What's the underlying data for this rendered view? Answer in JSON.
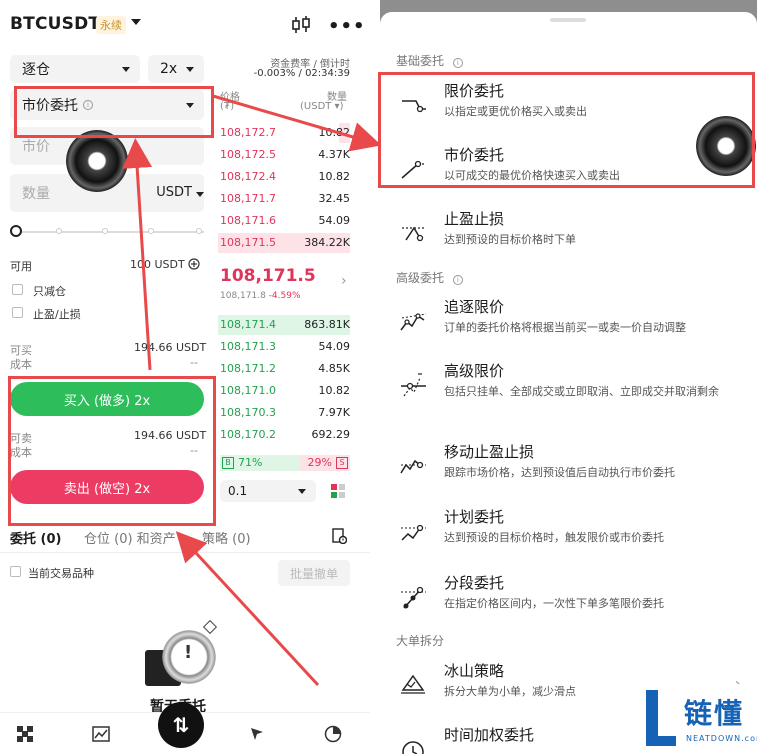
{
  "left": {
    "symbol": "BTCUSDT",
    "perp_badge": "永续",
    "margin_mode": "逐仓",
    "leverage": "2x",
    "funding_label": "资金费率 / 倒计时",
    "funding_value": "-0.003% / 02:34:39",
    "order_type": "市价委托",
    "price_placeholder": "市价",
    "qty_placeholder": "数量",
    "qty_unit": "USDT",
    "available_label": "可用",
    "available_value": "100 USDT",
    "reduce_only": "只减仓",
    "tp_sl": "止盈/止损",
    "can_buy_label": "可买",
    "can_buy_value": "194.66 USDT",
    "cost_label": "成本",
    "cost_value": "--",
    "buy_button": "买入 (做多) 2x",
    "can_sell_label": "可卖",
    "can_sell_value": "194.66 USDT",
    "cost2_label": "成本",
    "cost2_value": "--",
    "sell_button": "卖出 (做空) 2x",
    "orderbook": {
      "price_header": "价格",
      "price_unit": "(₮)",
      "qty_header": "数量",
      "qty_unit": "(USDT ▾)",
      "asks": [
        {
          "price": "108,172.7",
          "qty": "10.82",
          "depth": 0.08
        },
        {
          "price": "108,172.5",
          "qty": "4.37K",
          "depth": 0.0
        },
        {
          "price": "108,172.4",
          "qty": "10.82",
          "depth": 0.0
        },
        {
          "price": "108,171.7",
          "qty": "32.45",
          "depth": 0.0
        },
        {
          "price": "108,171.6",
          "qty": "54.09",
          "depth": 0.0
        },
        {
          "price": "108,171.5",
          "qty": "384.22K",
          "depth": 1.0
        }
      ],
      "mid_price": "108,171.5",
      "mark_price": "108,171.8",
      "change": "-4.59%",
      "bids": [
        {
          "price": "108,171.4",
          "qty": "863.81K",
          "depth": 1.0
        },
        {
          "price": "108,171.3",
          "qty": "54.09",
          "depth": 0.0
        },
        {
          "price": "108,171.2",
          "qty": "4.85K",
          "depth": 0.0
        },
        {
          "price": "108,171.0",
          "qty": "10.82",
          "depth": 0.0
        },
        {
          "price": "108,170.3",
          "qty": "7.97K",
          "depth": 0.0
        },
        {
          "price": "108,170.2",
          "qty": "692.29",
          "depth": 0.0
        }
      ],
      "buy_tag": "B",
      "buy_ratio": "71%",
      "sell_ratio": "29%",
      "sell_tag": "S",
      "precision": "0.1"
    },
    "tabs": {
      "orders": "委托 (0)",
      "positions": "仓位 (0) 和资产",
      "strategy": "策略 (0)"
    },
    "current_symbol_only": "当前交易品种",
    "batch_cancel": "批量撤单",
    "empty_text": "暂无委托",
    "nav_center": "⇅"
  },
  "right": {
    "basic_title": "基础委托",
    "advanced_title": "高级委托",
    "split_title": "大单拆分",
    "basic": [
      {
        "name": "限价委托",
        "desc": "以指定或更优价格买入或卖出"
      },
      {
        "name": "市价委托",
        "desc": "以可成交的最优价格快速买入或卖出"
      },
      {
        "name": "止盈止损",
        "desc": "达到预设的目标价格时下单"
      }
    ],
    "advanced": [
      {
        "name": "追逐限价",
        "desc": "订单的委托价格将根据当前买一或卖一价自动调整"
      },
      {
        "name": "高级限价",
        "desc": "包括只挂单、全部成交或立即取消、立即成交并取消剩余"
      },
      {
        "name": "移动止盈止损",
        "desc": "跟踪市场价格，达到预设值后自动执行市价委托"
      },
      {
        "name": "计划委托",
        "desc": "达到预设的目标价格时，触发限价或市价委托"
      },
      {
        "name": "分段委托",
        "desc": "在指定价格区间内，一次性下单多笔限价委托"
      }
    ],
    "split": [
      {
        "name": "冰山策略",
        "desc": "拆分大单为小单，减少滑点"
      },
      {
        "name": "时间加权委托",
        "desc": ""
      }
    ],
    "logo_cn": "链懂",
    "logo_en": "NEATDOWN.com"
  },
  "colors": {
    "buy": "#2dbd5a",
    "sell": "#ec3c64",
    "annotation": "#e8494b",
    "logo": "#1663b5"
  }
}
